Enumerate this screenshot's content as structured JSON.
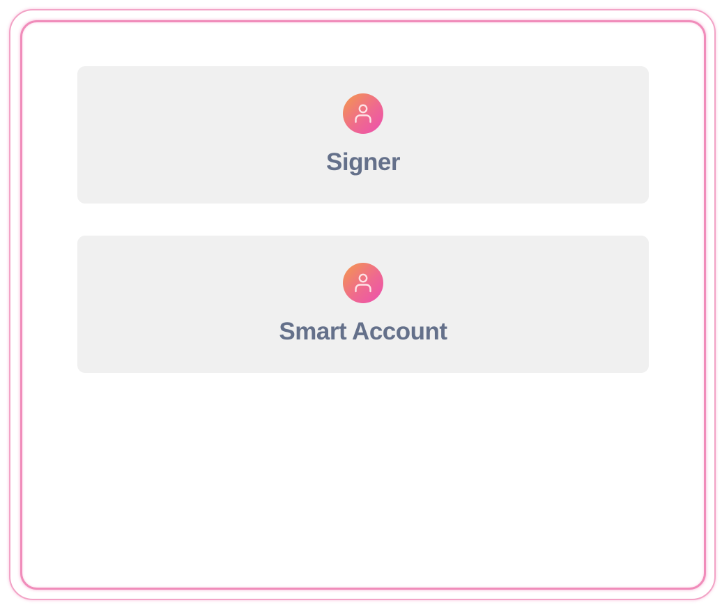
{
  "options": [
    {
      "label": "Signer",
      "icon": "user-icon"
    },
    {
      "label": "Smart Account",
      "icon": "user-icon"
    }
  ],
  "colors": {
    "frame_accent": "#f08cba",
    "card_background": "#f0f0f0",
    "label_text": "#64708a",
    "avatar_gradient_start": "#f39a4a",
    "avatar_gradient_end": "#ec4fb0"
  }
}
